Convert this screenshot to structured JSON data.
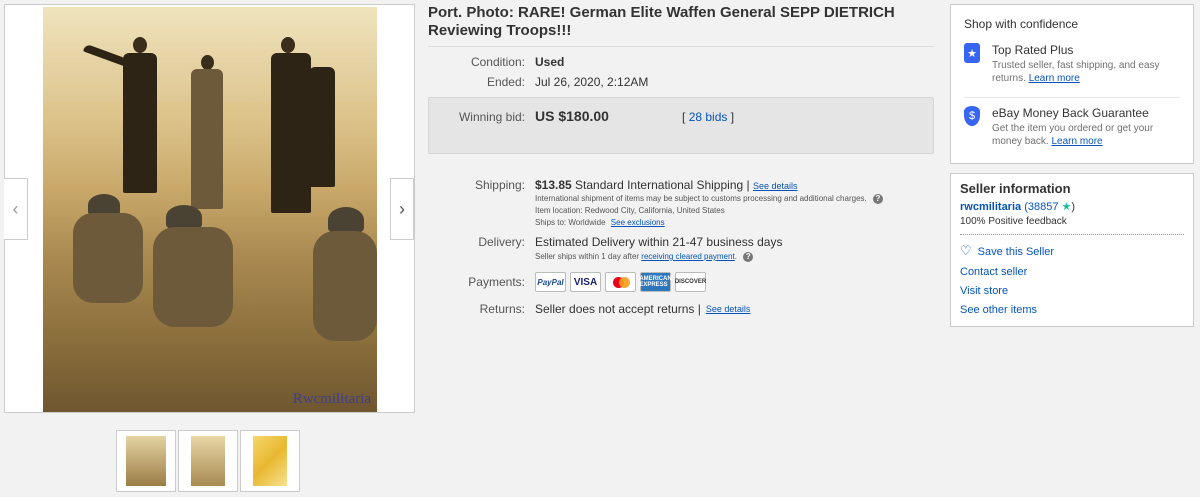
{
  "listing": {
    "title": "Port. Photo: RARE! German Elite Waffen General SEPP DIETRICH Reviewing Troops!!!",
    "watermark": "Rwcmilitaria"
  },
  "details": {
    "condition_label": "Condition:",
    "condition_value": "Used",
    "ended_label": "Ended:",
    "ended_value": "Jul 26, 2020, 2:12AM",
    "winning_bid_label": "Winning bid:",
    "winning_bid_value": "US $180.00",
    "bids_open": "[",
    "bids_link": "28 bids",
    "bids_close": "]",
    "shipping_label": "Shipping:",
    "shipping_price": "$13.85",
    "shipping_method": "Standard International Shipping |",
    "shipping_details_link": "See details",
    "shipping_note": "International shipment of items may be subject to customs processing and additional charges.",
    "item_location": "Item location:  Redwood City, California, United States",
    "ships_to": "Ships to:  Worldwide",
    "exclusions_link": "See exclusions",
    "delivery_label": "Delivery:",
    "delivery_value": "Estimated Delivery within 21-47 business days",
    "delivery_note": "Seller ships within 1 day after",
    "delivery_note_link": "receiving cleared payment",
    "delivery_note_end": ".",
    "payments_label": "Payments:",
    "payments": [
      "PayPal",
      "VISA",
      "",
      "AMERICAN EXPRESS",
      "DISCOVER"
    ],
    "returns_label": "Returns:",
    "returns_value": "Seller does not accept returns |",
    "returns_details_link": "See details"
  },
  "confidence": {
    "heading": "Shop with confidence",
    "top_rated_title": "Top Rated Plus",
    "top_rated_desc": "Trusted seller, fast shipping, and easy returns.",
    "top_rated_link": "Learn more",
    "guarantee_title": "eBay Money Back Guarantee",
    "guarantee_desc": "Get the item you ordered or get your money back.",
    "guarantee_link": "Learn more"
  },
  "seller": {
    "heading": "Seller information",
    "name": "rwcmilitaria",
    "score_open": "(38857",
    "score_close": ")",
    "feedback": "100% Positive feedback",
    "save": "Save this Seller",
    "contact": "Contact seller",
    "store": "Visit store",
    "other": "See other items"
  },
  "colors": {
    "link": "#0654ba",
    "badge_blue": "#3665f3",
    "star_teal": "#1abc9c"
  },
  "icons": [
    "chevron-left-icon",
    "chevron-right-icon",
    "top-rated-badge-icon",
    "shield-icon",
    "heart-icon",
    "star-icon",
    "help-icon"
  ]
}
